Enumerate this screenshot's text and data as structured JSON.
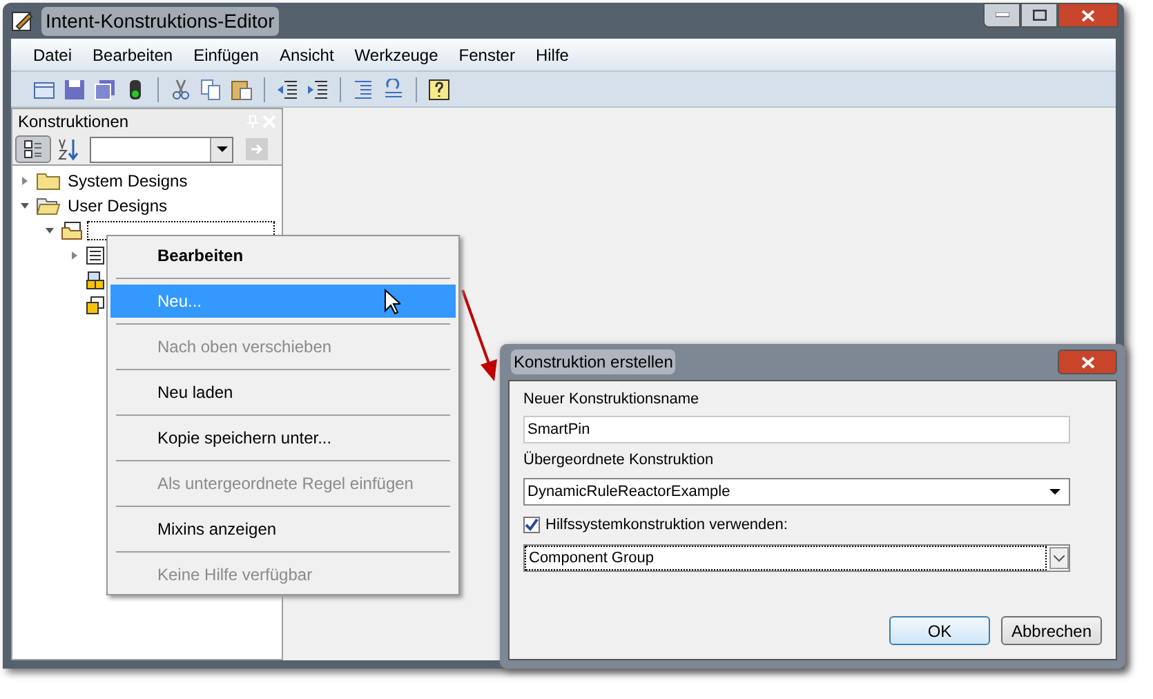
{
  "window": {
    "title": "Intent-Konstruktions-Editor"
  },
  "menu_bar": [
    "Datei",
    "Bearbeiten",
    "Einfügen",
    "Ansicht",
    "Werkzeuge",
    "Fenster",
    "Hilfe"
  ],
  "panel": {
    "title": "Konstruktionen",
    "tree": [
      {
        "label": "System Designs",
        "expanded": false
      },
      {
        "label": "User Designs",
        "expanded": true,
        "children": [
          {
            "expanded": true,
            "children": [
              {
                "expanded": false
              },
              {
                "kind": "item"
              },
              {
                "kind": "item"
              }
            ]
          }
        ]
      }
    ]
  },
  "context_menu": [
    {
      "label": "Bearbeiten",
      "bold": true,
      "selected": false,
      "disabled": false
    },
    {
      "label": "Neu...",
      "bold": false,
      "selected": true,
      "disabled": false
    },
    {
      "label": "Nach oben verschieben",
      "bold": false,
      "selected": false,
      "disabled": true
    },
    {
      "label": "Neu laden",
      "bold": false,
      "selected": false,
      "disabled": false
    },
    {
      "label": "Kopie speichern unter...",
      "bold": false,
      "selected": false,
      "disabled": false
    },
    {
      "label": "Als untergeordnete Regel einfügen",
      "bold": false,
      "selected": false,
      "disabled": true
    },
    {
      "label": "Mixins anzeigen",
      "bold": false,
      "selected": false,
      "disabled": false
    },
    {
      "label": "Keine Hilfe verfügbar",
      "bold": false,
      "selected": false,
      "disabled": true
    }
  ],
  "dialog": {
    "title": "Konstruktion erstellen",
    "name_label": "Neuer Konstruktionsname",
    "name_value": "SmartPin",
    "parent_label": "Übergeordnete Konstruktion",
    "parent_value": "DynamicRuleReactorExample",
    "helper_label": "Hilfssystemkonstruktion verwenden:",
    "helper_checked": true,
    "helper_value": "Component Group",
    "buttons": [
      "OK",
      "Abbrechen"
    ]
  }
}
